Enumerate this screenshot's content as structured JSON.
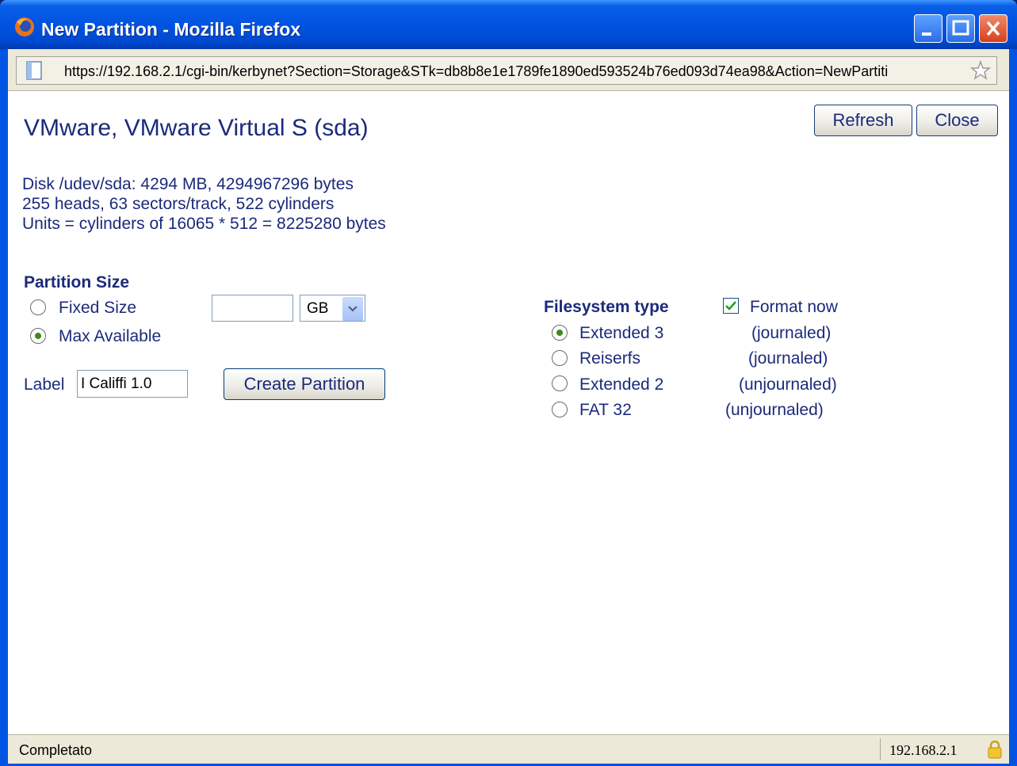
{
  "window": {
    "title": "New Partition - Mozilla Firefox"
  },
  "address_bar": {
    "url": "https://192.168.2.1/cgi-bin/kerbynet?Section=Storage&STk=db8b8e1e1789fe1890ed593524b76ed093d74ea98&Action=NewPartiti"
  },
  "page": {
    "title": "VMware, VMware Virtual S (sda)",
    "buttons": {
      "refresh": "Refresh",
      "close": "Close"
    },
    "disk_info": [
      "Disk /udev/sda: 4294 MB, 4294967296 bytes",
      "255 heads, 63 sectors/track, 522 cylinders",
      "Units = cylinders of 16065 * 512 = 8225280 bytes"
    ],
    "partition_size": {
      "heading": "Partition Size",
      "fixed_size_label": "Fixed Size",
      "max_available_label": "Max Available",
      "selected": "Max Available",
      "size_value": "",
      "unit_selected": "GB"
    },
    "label": {
      "text": "Label",
      "value": "I Califfi 1.0"
    },
    "create_button": "Create Partition",
    "filesystem": {
      "heading": "Filesystem type",
      "format_now_label": "Format now",
      "format_now_checked": true,
      "options": [
        {
          "name": "Extended 3",
          "note": "(journaled)",
          "selected": true
        },
        {
          "name": "Reiserfs",
          "note": "(journaled)",
          "selected": false
        },
        {
          "name": "Extended 2",
          "note": "(unjournaled)",
          "selected": false
        },
        {
          "name": "FAT 32",
          "note": "(unjournaled)",
          "selected": false
        }
      ]
    }
  },
  "status_bar": {
    "status": "Completato",
    "host": "192.168.2.1"
  }
}
